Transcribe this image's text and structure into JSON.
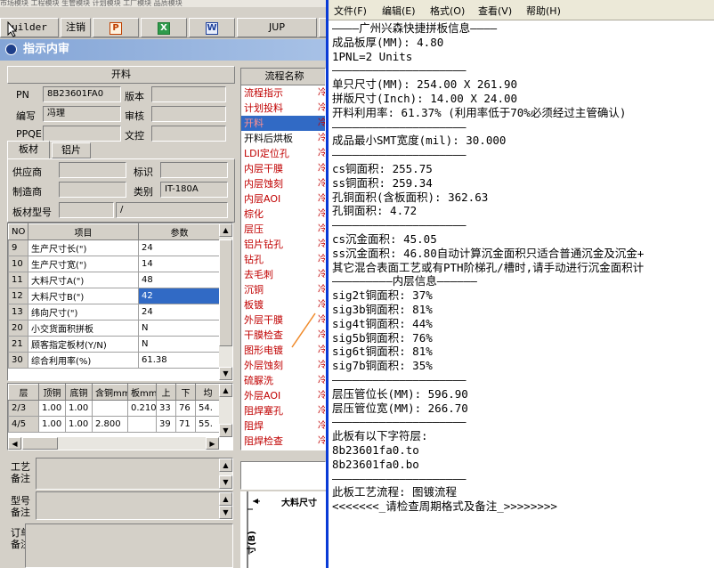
{
  "top_strip_text": "市场模块  工程模块  生管模块  计划模块  工厂模块  品质模块",
  "toolbar": {
    "builder": "uilder",
    "logout": "注销",
    "jup": "JUP"
  },
  "dialog": {
    "title": "指示内审",
    "section_kailiao": "开料",
    "fields": {
      "pn_label": "PN",
      "pn_value": "8B23601FA0",
      "version_label": "版本",
      "author_label": "编写",
      "author_value": "冯理",
      "reviewer_label": "审核",
      "ppqe_label": "PPQE",
      "document_label": "文控"
    },
    "tabs": [
      "板材",
      "铝片"
    ],
    "material": {
      "supplier_label": "供应商",
      "mark_label": "标识",
      "maker_label": "制造商",
      "category_label": "类别",
      "category_value": "IT-180A",
      "model_label": "板材型号",
      "model_value": "/"
    },
    "param_table": {
      "headers": [
        "NO",
        "项目",
        "参数"
      ],
      "rows": [
        [
          "9",
          "生产尺寸长(\")",
          "24"
        ],
        [
          "10",
          "生产尺寸宽(\")",
          "14"
        ],
        [
          "11",
          "大料尺寸A(\")",
          "48"
        ],
        [
          "12",
          "大料尺寸B(\")",
          "42"
        ],
        [
          "13",
          "纬向尺寸(\")",
          "24"
        ],
        [
          "20",
          "小交货面积拼板",
          "N"
        ],
        [
          "21",
          "顾客指定板材(Y/N)",
          "N"
        ],
        [
          "30",
          "综合利用率(%)",
          "61.38"
        ]
      ],
      "selected_row": 3
    },
    "layer_table": {
      "headers": [
        "层",
        "顶铜",
        "底铜",
        "含铜mm",
        "板mm",
        "上",
        "下",
        "均"
      ],
      "rows": [
        [
          "2/3",
          "1.00",
          "1.00",
          "",
          "0.210",
          "33",
          "76",
          "54."
        ],
        [
          "4/5",
          "1.00",
          "1.00",
          "2.800",
          "",
          "39",
          "71",
          "55."
        ]
      ]
    },
    "process_header": "流程名称",
    "process_items": [
      {
        "name": "流程指示",
        "color": "red"
      },
      {
        "name": "计划投料",
        "color": "red"
      },
      {
        "name": "开料",
        "color": "red",
        "selected": true
      },
      {
        "name": "开料后烘板",
        "color": "black"
      },
      {
        "name": "LDI定位孔",
        "color": "red"
      },
      {
        "name": "内层干膜",
        "color": "red"
      },
      {
        "name": "内层蚀刻",
        "color": "red"
      },
      {
        "name": "内层AOI",
        "color": "red"
      },
      {
        "name": "棕化",
        "color": "red"
      },
      {
        "name": "层压",
        "color": "red"
      },
      {
        "name": "铝片钻孔",
        "color": "red"
      },
      {
        "name": "钻孔",
        "color": "red"
      },
      {
        "name": "去毛刺",
        "color": "red"
      },
      {
        "name": "沉铜",
        "color": "red"
      },
      {
        "name": "板镀",
        "color": "red"
      },
      {
        "name": "外层干膜",
        "color": "red"
      },
      {
        "name": "干膜检查",
        "color": "red"
      },
      {
        "name": "图形电镀",
        "color": "red"
      },
      {
        "name": "外层蚀刻",
        "color": "red"
      },
      {
        "name": "硫脲洗",
        "color": "red"
      },
      {
        "name": "外层AOI",
        "color": "red"
      },
      {
        "name": "阻焊塞孔",
        "color": "red"
      },
      {
        "name": "阻焊",
        "color": "red"
      },
      {
        "name": "阻焊检查",
        "color": "red"
      }
    ],
    "process_col2": "冷",
    "notes": {
      "craft_label": "工艺\n备注",
      "model_label": "型号\n备注",
      "order_label": "订单\n备注"
    },
    "diagram": {
      "big_size_label": "大料尺寸",
      "vertical_label": "寸(B)"
    }
  },
  "notepad": {
    "menu": [
      "文件(F)",
      "编辑(E)",
      "格式(O)",
      "查看(V)",
      "帮助(H)"
    ],
    "lines": [
      "————广州兴森快捷拼板信息————",
      "成品板厚(MM): 4.80",
      "1PNL=2 Units",
      "————————————————————",
      "单只尺寸(MM): 254.00 X 261.90",
      "拼版尺寸(Inch): 14.00 X 24.00",
      "开料利用率: 61.37% (利用率低于70%必须经过主管确认)",
      "————————————————————",
      "成品最小SMT宽度(mil): 30.000",
      "————————————————————",
      "cs铜面积: 255.75",
      "ss铜面积: 259.34",
      "孔铜面积(含板面积): 362.63",
      "孔铜面积: 4.72",
      "————————————————————",
      "cs沉金面积: 45.05",
      "ss沉金面积: 46.80自动计算沉金面积只适合普通沉金及沉金+",
      "其它混合表面工艺或有PTH阶梯孔/槽时,请手动进行沉金面积计",
      "—————————内层信息——————",
      "sig2t铜面积: 37%",
      "sig3b铜面积: 81%",
      "sig4t铜面积: 44%",
      "sig5b铜面积: 76%",
      "sig6t铜面积: 81%",
      "sig7b铜面积: 35%",
      "————————————————————",
      "层压管位长(MM): 596.90",
      "层压管位宽(MM): 266.70",
      "————————————————————",
      "此板有以下字符层:",
      "8b23601fa0.to",
      "8b23601fa0.bo",
      "————————————————————",
      "此板工艺流程: 图镀流程",
      "<<<<<<<_请检查周期格式及备注_>>>>>>>>"
    ]
  }
}
